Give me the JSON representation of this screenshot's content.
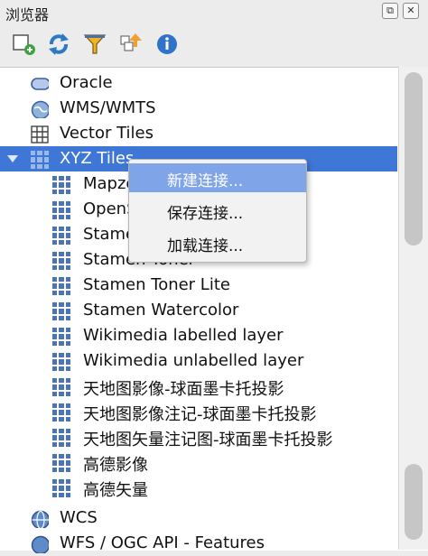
{
  "panel": {
    "title": "浏览器",
    "float_symbol": "⧉",
    "close_symbol": "✕"
  },
  "toolbar": [
    "add-layer-icon",
    "refresh-icon",
    "filter-icon",
    "collapse-all-icon",
    "properties-info-icon"
  ],
  "tree": {
    "items": [
      {
        "label": "Oracle"
      },
      {
        "label": "WMS/WMTS"
      },
      {
        "label": "Vector Tiles"
      },
      {
        "label": "XYZ Tiles",
        "expanded": true,
        "selected": true
      },
      {
        "label": "Mapzen Global Terrain"
      },
      {
        "label": "OpenStreetMap"
      },
      {
        "label": "Stamen Terrain"
      },
      {
        "label": "Stamen Toner"
      },
      {
        "label": "Stamen Toner Lite"
      },
      {
        "label": "Stamen Watercolor"
      },
      {
        "label": "Wikimedia labelled layer"
      },
      {
        "label": "Wikimedia unlabelled layer"
      },
      {
        "label": "天地图影像-球面墨卡托投影"
      },
      {
        "label": "天地图影像注记-球面墨卡托投影"
      },
      {
        "label": "天地图矢量注记图-球面墨卡托投影"
      },
      {
        "label": "高德影像"
      },
      {
        "label": "高德矢量"
      },
      {
        "label": "WCS"
      },
      {
        "label": "WFS / OGC API - Features"
      }
    ]
  },
  "context_menu": {
    "items": [
      {
        "label": "新建连接...",
        "highlighted": true
      },
      {
        "label": "保存连接..."
      },
      {
        "label": "加载连接..."
      }
    ]
  },
  "colors": {
    "selection": "#3f77d6",
    "menu_highlight": "#7fa4e8",
    "tile_icon": "#4a74b5"
  }
}
